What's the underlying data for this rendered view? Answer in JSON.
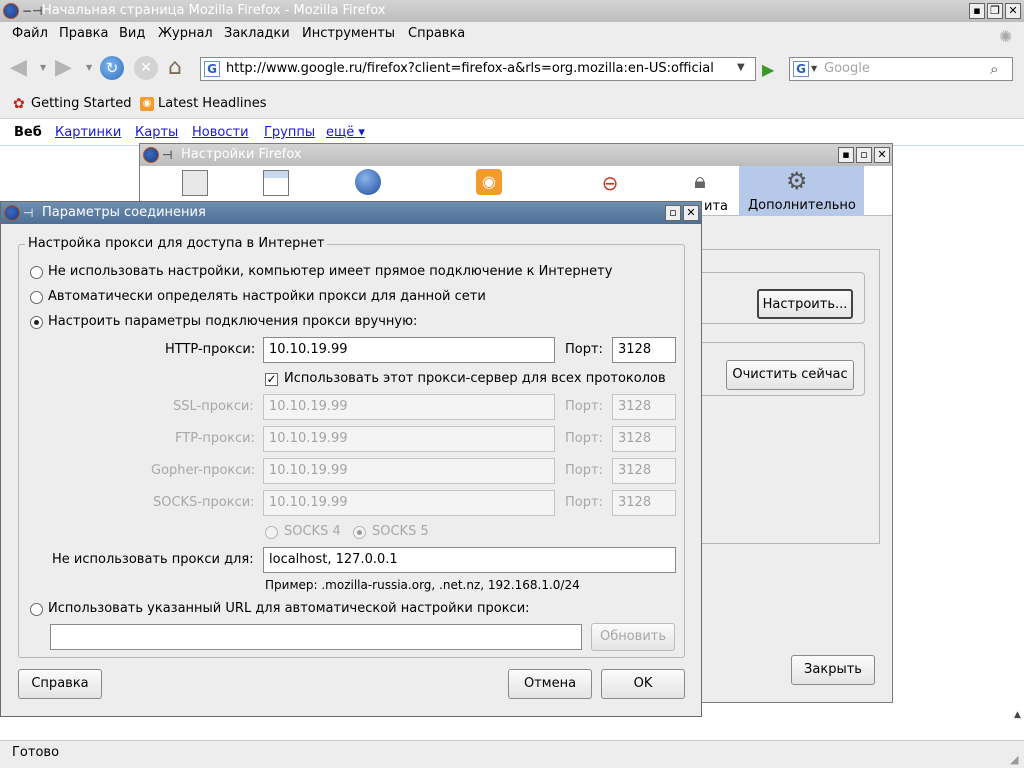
{
  "browser": {
    "title": "Начальная страница Mozilla Firefox - Mozilla Firefox",
    "menu": [
      "Файл",
      "Правка",
      "Вид",
      "Журнал",
      "Закладки",
      "Инструменты",
      "Справка"
    ],
    "url": "http://www.google.ru/firefox?client=firefox-a&rls=org.mozilla:en-US:official",
    "search_placeholder": "Google",
    "bookmarks": [
      "Getting Started",
      "Latest Headlines"
    ],
    "google_nav": [
      "Веб",
      "Картинки",
      "Карты",
      "Новости",
      "Группы",
      "ещё ▾"
    ],
    "status": "Готово",
    "colors": {
      "link": "#1a1ad0",
      "chrome": "#ededed",
      "selected_pane": "#b7c9e8"
    }
  },
  "prefs": {
    "title": "Настройки Firefox",
    "panes": [
      "",
      "",
      "",
      "",
      "",
      "ита",
      "Дополнительно"
    ],
    "configure_button": "Настроить...",
    "clear_button": "Очистить сейчас",
    "close_button": "Закрыть"
  },
  "conn": {
    "title": "Параметры соединения",
    "group_title": "Настройка прокси для доступа в Интернет",
    "opt_none": "Не использовать настройки, компьютер имеет прямое подключение к Интернету",
    "opt_auto": "Автоматически определять настройки прокси для данной сети",
    "opt_manual": "Настроить параметры подключения прокси вручную:",
    "http_label": "HTTP-прокси:",
    "http_value": "10.10.19.99",
    "port_label": "Порт:",
    "http_port": "3128",
    "use_all_label": "Использовать этот прокси-сервер для всех протоколов",
    "ssl_label": "SSL-прокси:",
    "ssl_value": "10.10.19.99",
    "ssl_port": "3128",
    "ftp_label": "FTP-прокси:",
    "ftp_value": "10.10.19.99",
    "ftp_port": "3128",
    "gopher_label": "Gopher-прокси:",
    "gopher_value": "10.10.19.99",
    "gopher_port": "3128",
    "socks_label": "SOCKS-прокси:",
    "socks_value": "10.10.19.99",
    "socks_port": "3128",
    "socks4": "SOCKS 4",
    "socks5": "SOCKS 5",
    "noproxy_label": "Не использовать прокси для:",
    "noproxy_value": "localhost, 127.0.0.1",
    "example": "Пример: .mozilla-russia.org, .net.nz, 192.168.1.0/24",
    "opt_pac": "Использовать указанный URL для автоматической настройки прокси:",
    "pac_value": "",
    "reload_button": "Обновить",
    "help_button": "Справка",
    "cancel_button": "Отмена",
    "ok_button": "OK"
  }
}
